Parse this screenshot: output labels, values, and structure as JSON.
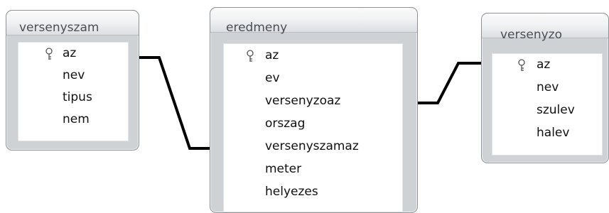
{
  "tables": {
    "versenyszam": {
      "title": "versenyszam",
      "fields": [
        "az",
        "nev",
        "tipus",
        "nem"
      ]
    },
    "eredmeny": {
      "title": "eredmeny",
      "fields": [
        "az",
        "ev",
        "versenyzoaz",
        "orszag",
        "versenyszamaz",
        "meter",
        "helyezes"
      ]
    },
    "versenyzo": {
      "title": "versenyzo",
      "fields": [
        "az",
        "nev",
        "szulev",
        "halev"
      ]
    }
  },
  "icons": {
    "primary_key": "key-icon"
  },
  "colors": {
    "window_frame": "#cfd2d5",
    "relationship_line": "#000000"
  }
}
